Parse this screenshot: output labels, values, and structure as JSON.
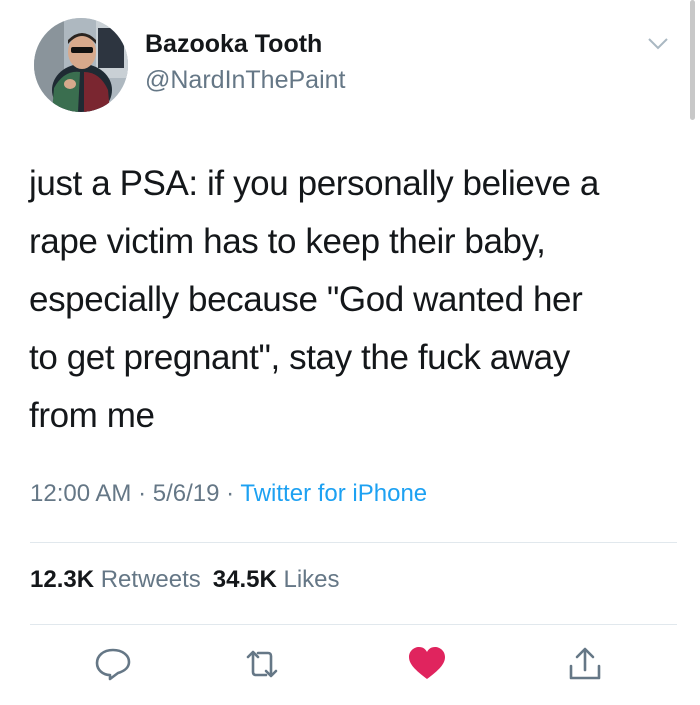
{
  "user": {
    "display_name": "Bazooka Tooth",
    "handle": "@NardInThePaint",
    "avatar_icon": "profile-photo"
  },
  "tweet": {
    "text_lines": [
      "just a PSA: if you personally believe a",
      "rape victim has to keep their baby,",
      "especially because \"God wanted her",
      "to get pregnant\", stay the fuck away",
      "from me"
    ],
    "time": "12:00 AM",
    "date": "5/6/19",
    "source": "Twitter for iPhone",
    "separator": "·"
  },
  "stats": {
    "retweets_count": "12.3K",
    "retweets_label": "Retweets",
    "likes_count": "34.5K",
    "likes_label": "Likes"
  },
  "actions": {
    "reply_icon": "speech-bubble",
    "retweet_icon": "retweet-arrows",
    "like_icon": "heart",
    "share_icon": "share-upload",
    "like_color": "#e0245e",
    "icon_color": "#657786"
  },
  "colors": {
    "link": "#1da1f2",
    "muted": "#657786",
    "text": "#14171a"
  }
}
